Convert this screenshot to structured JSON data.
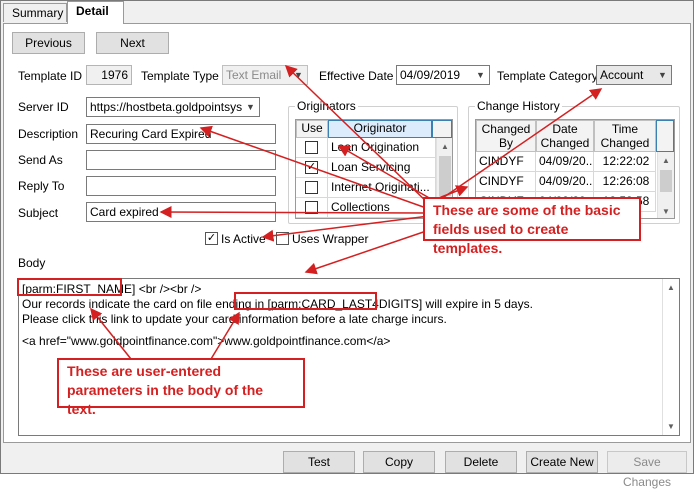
{
  "tabs": [
    {
      "label": "Summary",
      "active": false
    },
    {
      "label": "Detail",
      "active": true
    }
  ],
  "nav": {
    "previous_label": "Previous",
    "next_label": "Next"
  },
  "form": {
    "template_id_label": "Template ID",
    "template_id_value": "1976",
    "template_type_label": "Template Type",
    "template_type_value": "Text Email",
    "effective_date_label": "Effective Date",
    "effective_date_value": "04/09/2019",
    "template_category_label": "Template Category",
    "template_category_value": "Account",
    "server_id_label": "Server ID",
    "server_id_value": "https://hostbeta.goldpointsystems/",
    "description_label": "Description",
    "description_value": "Recuring Card Expired",
    "send_as_label": "Send As",
    "send_as_value": "",
    "reply_to_label": "Reply To",
    "reply_to_value": "",
    "subject_label": "Subject",
    "subject_value": "Card expired",
    "is_active_label": "Is Active",
    "is_active_checked": true,
    "uses_wrapper_label": "Uses Wrapper",
    "uses_wrapper_checked": false,
    "body_label": "Body"
  },
  "originators": {
    "title": "Originators",
    "headers": [
      "Use",
      "Originator"
    ],
    "rows": [
      {
        "use": false,
        "name": "Loan Origination"
      },
      {
        "use": true,
        "name": "Loan Servicing"
      },
      {
        "use": false,
        "name": "Internet Originati..."
      },
      {
        "use": false,
        "name": "Collections"
      }
    ]
  },
  "change_history": {
    "title": "Change History",
    "headers": [
      "Changed By",
      "Date Changed",
      "Time Changed"
    ],
    "rows": [
      [
        "CINDYF",
        "04/09/20...",
        "12:22:02"
      ],
      [
        "CINDYF",
        "04/09/20...",
        "12:26:08"
      ],
      [
        "CINDYF",
        "04/09/20...",
        "12:58:58"
      ]
    ]
  },
  "body": {
    "line1_param": "[parm:FIRST_NAME]",
    "line1_rest": " <br /><br />",
    "line2_pre": "Our records indicate the card on file ending in ",
    "line2_param": "[parm:CARD_LAST4DIGITS]",
    "line2_post": " will expire in 5 days.",
    "line3": "Please click this link to update your card information before a late charge incurs.",
    "line4": "<a href=\"www.goldpointfinance.com\">www.goldpointfinance.com</a>"
  },
  "bottom_buttons": {
    "test": "Test",
    "copy": "Copy",
    "delete": "Delete",
    "create_new": "Create New",
    "save_changes": "Save Changes"
  },
  "annotations": {
    "fields_callout": "These are some of the basic fields used to create templates.",
    "params_callout": "These are user-entered parameters in the body of the text."
  },
  "colors": {
    "annotation": "#d42020",
    "grid_header_selected": "#dcecfc"
  }
}
